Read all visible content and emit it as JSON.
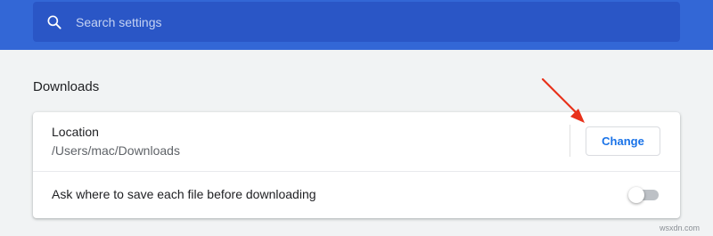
{
  "search": {
    "placeholder": "Search settings",
    "value": ""
  },
  "downloads": {
    "section_title": "Downloads",
    "location": {
      "label": "Location",
      "path": "/Users/mac/Downloads",
      "change_label": "Change"
    },
    "ask_before_download": {
      "label": "Ask where to save each file before downloading",
      "enabled": false
    }
  },
  "annotation": {
    "arrow_color": "#e8311a"
  },
  "watermark": "wsxdn.com",
  "colors": {
    "header": "#3367d6",
    "search_bg": "#2a56c6",
    "accent": "#1a73e8",
    "page_bg": "#f1f3f4"
  }
}
